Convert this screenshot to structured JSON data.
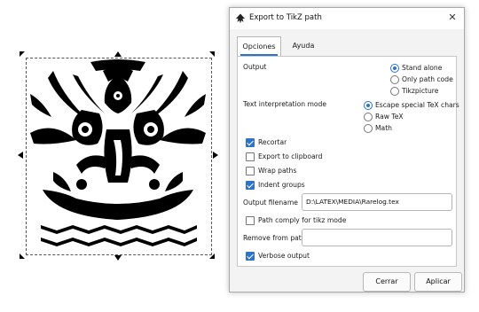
{
  "dialog": {
    "title": "Export to TikZ path",
    "close_glyph": "✕"
  },
  "tabs": [
    {
      "label": "Opciones",
      "active": true
    },
    {
      "label": "Ayuda",
      "active": false
    }
  ],
  "output": {
    "label": "Output",
    "options": [
      {
        "label": "Stand alone",
        "selected": true
      },
      {
        "label": "Only path code",
        "selected": false
      },
      {
        "label": "Tikzpicture",
        "selected": false
      }
    ]
  },
  "text_mode": {
    "label": "Text interpretation mode",
    "options": [
      {
        "label": "Escape special TeX chars",
        "selected": true
      },
      {
        "label": "Raw TeX",
        "selected": false
      },
      {
        "label": "Math",
        "selected": false
      }
    ]
  },
  "checkboxes": [
    {
      "label": "Recortar",
      "checked": true
    },
    {
      "label": "Export to clipboard",
      "checked": false
    },
    {
      "label": "Wrap paths",
      "checked": false
    },
    {
      "label": "Indent groups",
      "checked": true
    }
  ],
  "filename": {
    "label": "Output filename",
    "value": "D:\\LATEX\\MEDIA\\Rarelog.tex"
  },
  "path_comply": {
    "label": "Path comply for tikz mode",
    "checked": false
  },
  "remove_path": {
    "label": "Remove from path",
    "value": ""
  },
  "verbose": {
    "label": "Verbose output",
    "checked": true
  },
  "buttons": {
    "cancel": "Cerrar",
    "apply": "Aplicar"
  },
  "colors": {
    "accent": "#2f73c9",
    "artwork": "#000000"
  }
}
